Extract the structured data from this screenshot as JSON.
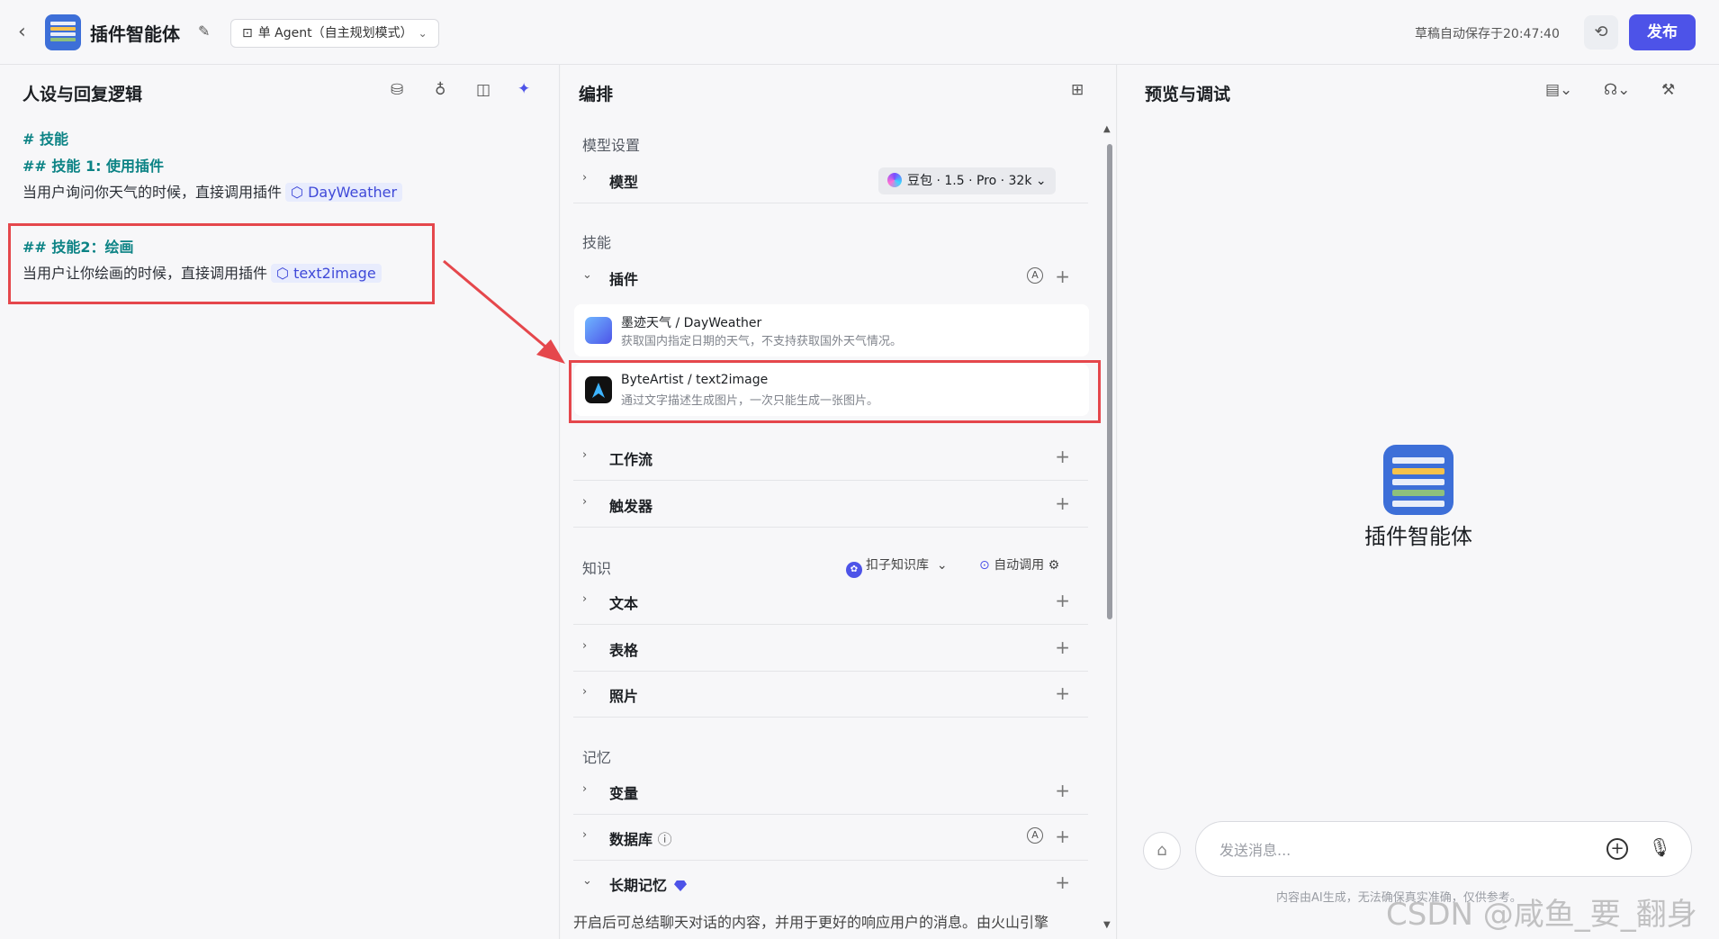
{
  "header": {
    "app_title": "插件智能体",
    "agent_mode": "单 Agent（自主规划模式）",
    "saved_status": "草稿自动保存于20:47:40",
    "publish_label": "发布"
  },
  "left_panel": {
    "title": "人设与回复逻辑",
    "lines": {
      "h_skills": "# 技能",
      "h_skill1": "## 技能 1: 使用插件",
      "skill1_text": "当用户询问你天气的时候，直接调用插件",
      "skill1_plugin": "DayWeather",
      "h_skill2": "## 技能2：绘画",
      "skill2_text": "当用户让你绘画的时候，直接调用插件",
      "skill2_plugin": "text2image"
    }
  },
  "mid_panel": {
    "title": "编排",
    "model_section": "模型设置",
    "model_label": "模型",
    "model_value": "豆包 · 1.5 · Pro · 32k",
    "skills_section": "技能",
    "plugins_label": "插件",
    "plugins": [
      {
        "name": "墨迹天气 / DayWeather",
        "desc": "获取国内指定日期的天气，不支持获取国外天气情况。"
      },
      {
        "name": "ByteArtist / text2image",
        "desc": "通过文字描述生成图片，一次只能生成一张图片。"
      }
    ],
    "workflow_label": "工作流",
    "trigger_label": "触发器",
    "knowledge_section": "知识",
    "kb_select": "扣子知识库",
    "auto_call": "自动调用",
    "text_label": "文本",
    "table_label": "表格",
    "photo_label": "照片",
    "memory_section": "记忆",
    "variable_label": "变量",
    "database_label": "数据库",
    "ltm_label": "长期记忆",
    "ltm_desc": "开启后可总结聊天对话的内容，并用于更好的响应用户的消息。由火山引擎"
  },
  "right_panel": {
    "title": "预览与调试",
    "bot_name": "插件智能体",
    "input_placeholder": "发送消息...",
    "disclaimer": "内容由AI生成，无法确保真实准确，仅供参考。",
    "watermark": "CSDN @咸鱼_要_翻身"
  },
  "colors": {
    "accent": "#4d53e8",
    "teal_heading": "#0c8385",
    "highlight_red": "#e5474c"
  }
}
